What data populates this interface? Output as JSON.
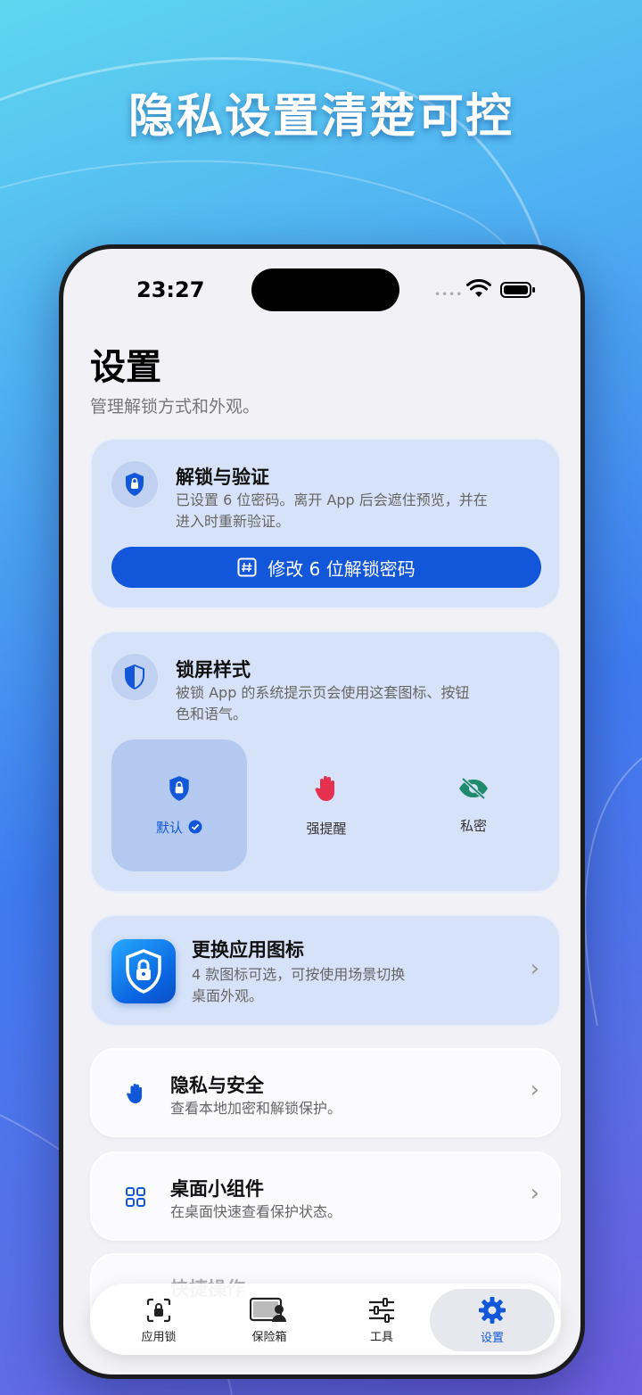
{
  "promo": {
    "title": "隐私设置清楚可控"
  },
  "status_bar": {
    "time": "23:27"
  },
  "header": {
    "title": "设置",
    "subtitle": "管理解锁方式和外观。"
  },
  "unlock_card": {
    "title": "解锁与验证",
    "desc_line1": "已设置 6 位密码。离开 App 后会遮住预览，并在",
    "desc_line2": "进入时重新验证。",
    "button_label": "修改 6 位解锁密码"
  },
  "lock_style_card": {
    "title": "锁屏样式",
    "desc_line1": "被锁 App 的系统提示页会使用这套图标、按钮",
    "desc_line2": "色和语气。",
    "options": [
      {
        "label": "默认",
        "selected": true
      },
      {
        "label": "强提醒",
        "selected": false
      },
      {
        "label": "私密",
        "selected": false
      }
    ]
  },
  "app_icon_card": {
    "title": "更换应用图标",
    "desc_line1": "4 款图标可选，可按使用场景切换",
    "desc_line2": "桌面外观。"
  },
  "rows": [
    {
      "title": "隐私与安全",
      "desc": "查看本地加密和解锁保护。",
      "icon": "hand-icon"
    },
    {
      "title": "桌面小组件",
      "desc": "在桌面快速查看保护状态。",
      "icon": "grid-icon"
    }
  ],
  "partial_row": {
    "title": "快捷操作"
  },
  "tab_bar": {
    "tabs": [
      {
        "label": "应用锁",
        "icon": "app-lock-icon"
      },
      {
        "label": "保险箱",
        "icon": "vault-icon"
      },
      {
        "label": "工具",
        "icon": "sliders-icon"
      },
      {
        "label": "设置",
        "icon": "gear-icon",
        "active": true
      }
    ]
  },
  "colors": {
    "accent": "#1257d9",
    "card_blue": "#d6e2f7",
    "alert_red": "#e53050",
    "private_green": "#1f8a6c"
  }
}
